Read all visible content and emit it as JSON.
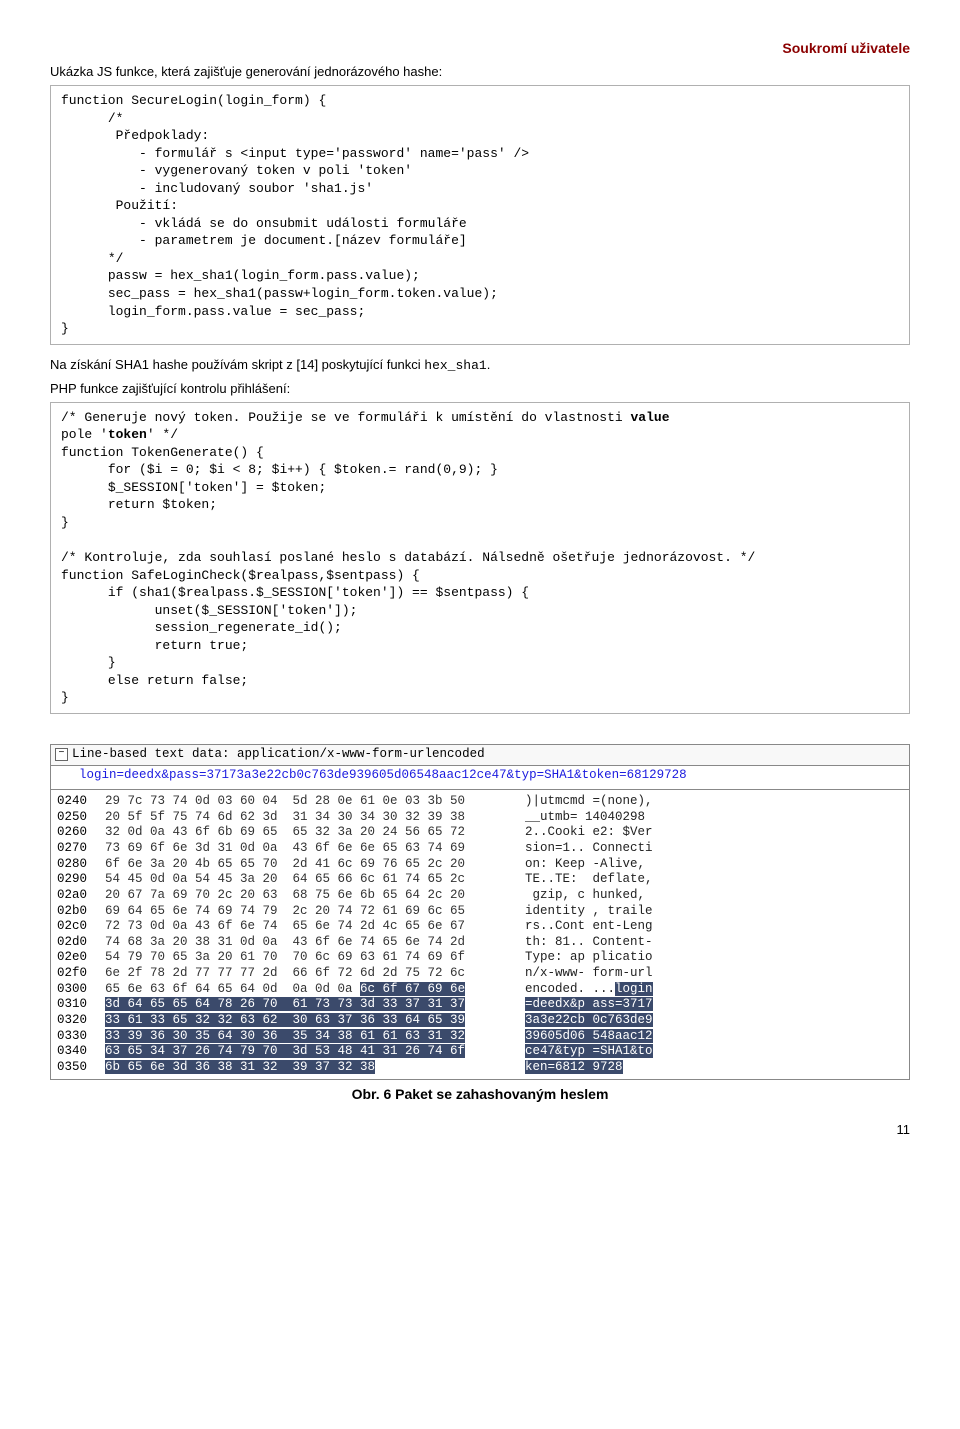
{
  "header": {
    "right": "Soukromí uživatele"
  },
  "intro": "Ukázka JS funkce, která zajišťuje generování jednorázového hashe:",
  "code1": "function SecureLogin(login_form) {\n      /*\n       Předpoklady:\n          - formulář s <input type='password' name='pass' />\n          - vygenerovaný token v poli 'token'\n          - includovaný soubor 'sha1.js'\n       Použití:\n          - vkládá se do onsubmit události formuláře\n          - parametrem je document.[název formuláře]\n      */\n      passw = hex_sha1(login_form.pass.value);\n      sec_pass = hex_sha1(passw+login_form.token.value);\n      login_form.pass.value = sec_pass;\n}",
  "mid1_a": "Na získání SHA1 hashe používám skript z [14] poskytující funkci ",
  "mid1_b": "hex_sha1",
  "mid1_c": ".",
  "mid2": "PHP funkce zajišťující kontrolu přihlášení:",
  "code2_l1": "/* Generuje nový token. Použije se ve formuláři k umístění do vlastnosti ",
  "code2_l1b": "value",
  "code2_l2a": "pole '",
  "code2_l2b": "token",
  "code2_l2c": "' */",
  "code2_rest": "function TokenGenerate() {\n      for ($i = 0; $i < 8; $i++) { $token.= rand(0,9); }\n      $_SESSION['token'] = $token;\n      return $token;\n}\n\n/* Kontroluje, zda souhlasí poslané heslo s databází. Nálsedně ošetřuje jednorázovost. */\nfunction SafeLoginCheck($realpass,$sentpass) {\n      if (sha1($realpass.$_SESSION['token']) == $sentpass) {\n            unset($_SESSION['token']);\n            session_regenerate_id();\n            return true;\n      }\n      else return false;\n}",
  "packet": {
    "header": "Line-based text data: application/x-www-form-urlencoded",
    "postline": "login=deedx&pass=37173a3e22cb0c763de939605d06548aac12ce47&typ=SHA1&token=68129728"
  },
  "hex": {
    "rows": [
      {
        "addr": "0240",
        "bytes": "29 7c 73 74 0d 03 60 04  5d 28 0e 61 0e 03 3b 50",
        "ascii": ")|utmcmd =(none),"
      },
      {
        "addr": "0250",
        "bytes": "20 5f 5f 75 74 6d 62 3d  31 34 30 34 30 32 39 38",
        "ascii": "__utmb= 14040298"
      },
      {
        "addr": "0260",
        "bytes": "32 0d 0a 43 6f 6b 69 65  65 32 3a 20 24 56 65 72",
        "ascii": "2..Cooki e2: $Ver"
      },
      {
        "addr": "0270",
        "bytes": "73 69 6f 6e 3d 31 0d 0a  43 6f 6e 6e 65 63 74 69",
        "ascii": "sion=1.. Connecti"
      },
      {
        "addr": "0280",
        "bytes": "6f 6e 3a 20 4b 65 65 70  2d 41 6c 69 76 65 2c 20",
        "ascii": "on: Keep -Alive, "
      },
      {
        "addr": "0290",
        "bytes": "54 45 0d 0a 54 45 3a 20  64 65 66 6c 61 74 65 2c",
        "ascii": "TE..TE:  deflate,"
      },
      {
        "addr": "02a0",
        "bytes": "20 67 7a 69 70 2c 20 63  68 75 6e 6b 65 64 2c 20",
        "ascii": " gzip, c hunked, "
      },
      {
        "addr": "02b0",
        "bytes": "69 64 65 6e 74 69 74 79  2c 20 74 72 61 69 6c 65",
        "ascii": "identity , traile"
      },
      {
        "addr": "02c0",
        "bytes": "72 73 0d 0a 43 6f 6e 74  65 6e 74 2d 4c 65 6e 67",
        "ascii": "rs..Cont ent-Leng"
      },
      {
        "addr": "02d0",
        "bytes": "74 68 3a 20 38 31 0d 0a  43 6f 6e 74 65 6e 74 2d",
        "ascii": "th: 81.. Content-"
      },
      {
        "addr": "02e0",
        "bytes": "54 79 70 65 3a 20 61 70  70 6c 69 63 61 74 69 6f",
        "ascii": "Type: ap plicatio"
      },
      {
        "addr": "02f0",
        "bytes": "6e 2f 78 2d 77 77 77 2d  66 6f 72 6d 2d 75 72 6c",
        "ascii": "n/x-www- form-url"
      },
      {
        "addr": "0300",
        "bytes": "65 6e 63 6f 64 65 64 0d  0a 0d 0a ",
        "ascii": "encoded. ...",
        "hlb": "6c 6f 67 69 6e",
        "hla": "login"
      },
      {
        "addr": "0310",
        "bytes": "",
        "hlb": "3d 64 65 65 64 78 26 70  61 73 73 3d 33 37 31 37",
        "ascii": "",
        "hla": "=deedx&p ass=3717"
      },
      {
        "addr": "0320",
        "bytes": "",
        "hlb": "33 61 33 65 32 32 63 62  30 63 37 36 33 64 65 39",
        "ascii": "",
        "hla": "3a3e22cb 0c763de9"
      },
      {
        "addr": "0330",
        "bytes": "",
        "hlb": "33 39 36 30 35 64 30 36  35 34 38 61 61 63 31 32",
        "ascii": "",
        "hla": "39605d06 548aac12"
      },
      {
        "addr": "0340",
        "bytes": "",
        "hlb": "63 65 34 37 26 74 79 70  3d 53 48 41 31 26 74 6f",
        "ascii": "",
        "hla": "ce47&typ =SHA1&to"
      },
      {
        "addr": "0350",
        "bytes": "",
        "hlb": "6b 65 6e 3d 36 38 31 32  39 37 32 38",
        "ascii": "",
        "hla": "ken=6812 9728"
      }
    ]
  },
  "caption": "Obr. 6 Paket se zahashovaným heslem",
  "pagenum": "11"
}
